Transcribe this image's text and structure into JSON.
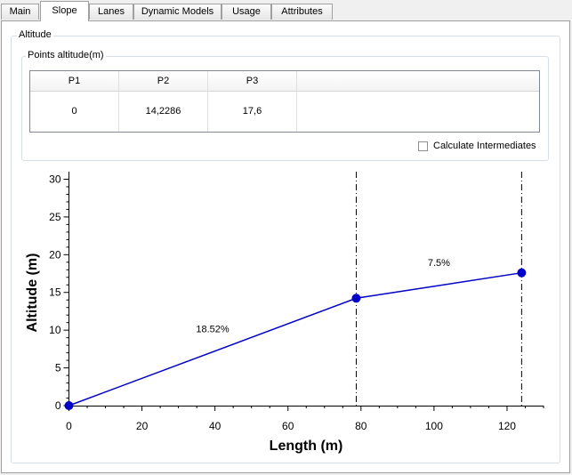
{
  "tabs": [
    {
      "label": "Main"
    },
    {
      "label": "Slope"
    },
    {
      "label": "Lanes"
    },
    {
      "label": "Dynamic Models"
    },
    {
      "label": "Usage"
    },
    {
      "label": "Attributes"
    }
  ],
  "altitude_group": {
    "title": "Altitude"
  },
  "points_group": {
    "title": "Points altitude(m)"
  },
  "table": {
    "headers": [
      "P1",
      "P2",
      "P3",
      ""
    ],
    "values": [
      "0",
      "14,2286",
      "17,6",
      ""
    ]
  },
  "calculate_intermediates": {
    "label": "Calculate Intermediates",
    "checked": false
  },
  "chart_data": {
    "type": "line",
    "xlabel": "Length (m)",
    "ylabel": "Altitude (m)",
    "xlim": [
      0,
      130
    ],
    "ylim": [
      0,
      31
    ],
    "xticks": [
      0,
      20,
      40,
      60,
      80,
      100,
      120
    ],
    "yticks": [
      0,
      5,
      10,
      15,
      20,
      25,
      30
    ],
    "points": [
      {
        "x": 0,
        "y": 0
      },
      {
        "x": 78.7,
        "y": 14.2286
      },
      {
        "x": 124,
        "y": 17.6
      }
    ],
    "segment_labels": [
      "18.52%",
      "7.5%"
    ],
    "vertical_lines_at": [
      78.7,
      124
    ],
    "series_color": "#0000c8"
  }
}
